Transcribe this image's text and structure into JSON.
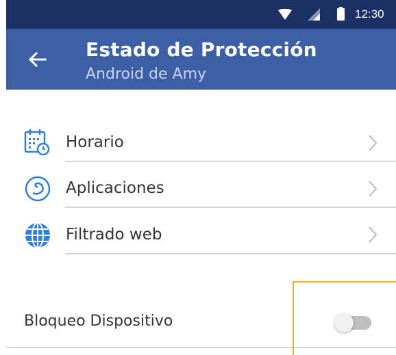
{
  "status_bar": {
    "time": "12:30",
    "icons": [
      "wifi-icon",
      "signal-icon",
      "battery-icon"
    ]
  },
  "app_bar": {
    "title": "Estado de Protección",
    "subtitle": "Android de Amy",
    "back_icon": "back-arrow-icon"
  },
  "menu": {
    "items": [
      {
        "label": "Horario",
        "icon": "calendar-clock-icon"
      },
      {
        "label": "Aplicaciones",
        "icon": "apps-icon"
      },
      {
        "label": "Filtrado web",
        "icon": "globe-icon"
      }
    ]
  },
  "device_lock": {
    "label": "Bloqueo Dispositivo",
    "enabled": false
  },
  "colors": {
    "status_bar": "#1c3066",
    "app_bar": "#3d5fa6",
    "icon_blue": "#2f7fd8",
    "highlight": "#f0b400"
  }
}
